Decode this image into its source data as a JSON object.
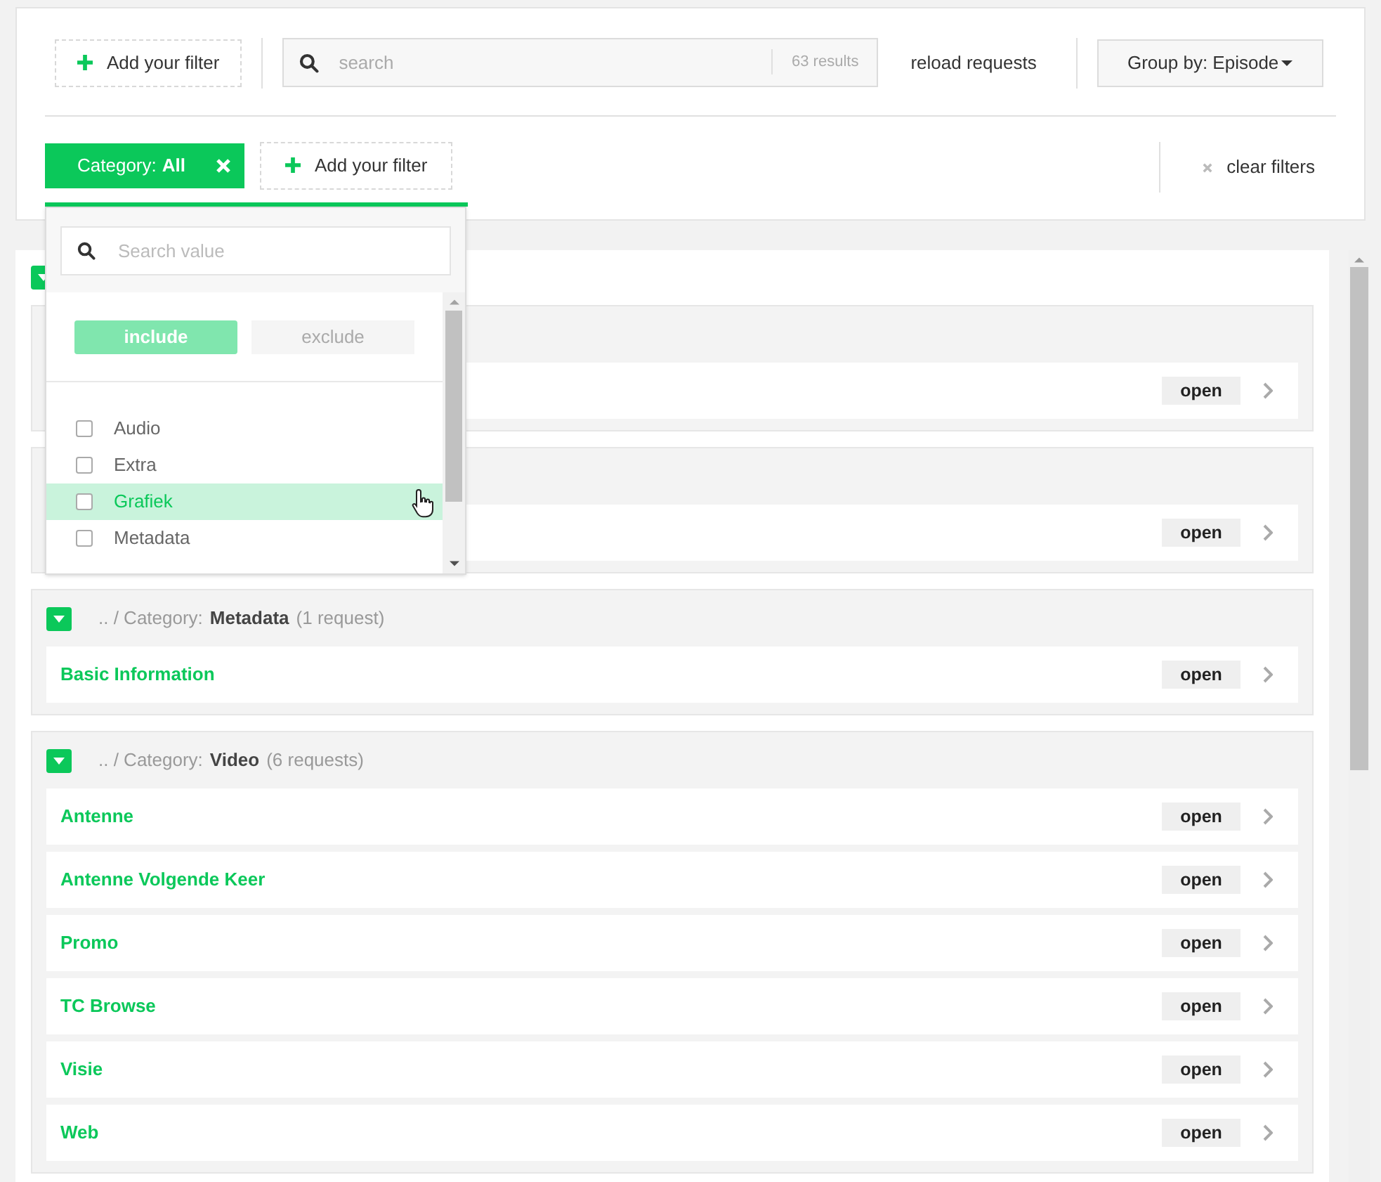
{
  "top_bar": {
    "add_filter": "Add your filter",
    "search": {
      "placeholder": "search"
    },
    "results": "63 results",
    "reload": "reload requests",
    "group_by": "Group by: Episode"
  },
  "filter_bar": {
    "chips": [
      {
        "key": "Category:",
        "value": "All"
      }
    ],
    "add_filter": "Add your filter",
    "clear": "clear filters"
  },
  "dropdown": {
    "search": {
      "placeholder": "Search value"
    },
    "modes": [
      {
        "label": "include",
        "selected": true
      },
      {
        "label": "exclude",
        "selected": false
      }
    ],
    "options": [
      {
        "label": "Audio",
        "checked": false,
        "hovered": false
      },
      {
        "label": "Extra",
        "checked": false,
        "hovered": false
      },
      {
        "label": "Grafiek",
        "checked": false,
        "hovered": true
      },
      {
        "label": "Metadata",
        "checked": false,
        "hovered": false
      }
    ]
  },
  "episode": {
    "expanded": true
  },
  "groups": [
    {
      "items": [
        {
          "action": "open"
        }
      ]
    },
    {
      "items": [
        {
          "action": "open"
        }
      ]
    },
    {
      "expanded": true,
      "path": ".. / Category:",
      "name": "Metadata",
      "count": "(1 request)",
      "items": [
        {
          "title": "Basic Information",
          "action": "open"
        }
      ]
    },
    {
      "expanded": true,
      "path": ".. / Category:",
      "name": "Video",
      "count": "(6 requests)",
      "items": [
        {
          "title": "Antenne",
          "action": "open"
        },
        {
          "title": "Antenne Volgende Keer",
          "action": "open"
        },
        {
          "title": "Promo",
          "action": "open"
        },
        {
          "title": "TC Browse",
          "action": "open"
        },
        {
          "title": "Visie",
          "action": "open"
        },
        {
          "title": "Web",
          "action": "open"
        }
      ]
    }
  ]
}
